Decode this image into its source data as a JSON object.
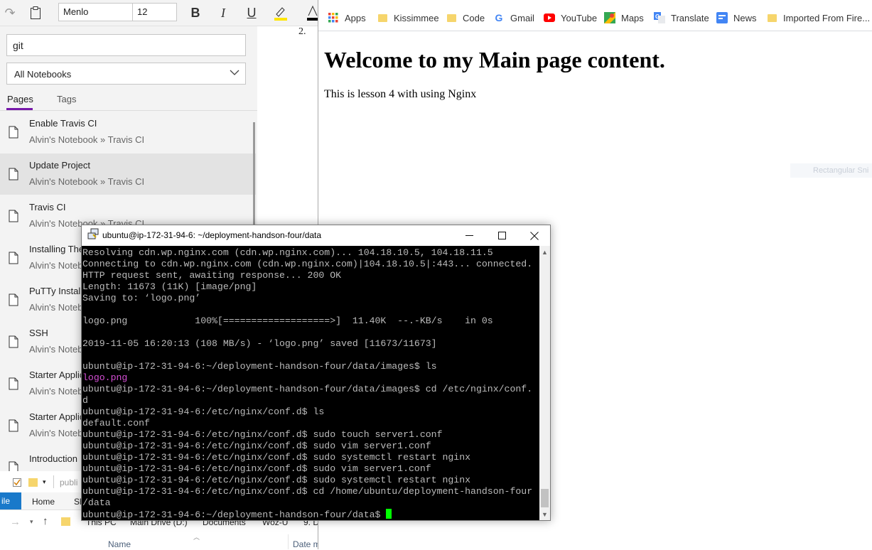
{
  "onenote": {
    "font_name": "Menlo",
    "font_size": "12",
    "search_value": "git",
    "notebook_filter": "All Notebooks",
    "tabs": [
      "Pages",
      "Tags"
    ],
    "results": [
      {
        "title": "Enable Travis CI",
        "path": "Alvin's Notebook » Travis CI",
        "selected": false
      },
      {
        "title": "Update Project",
        "path": "Alvin's Notebook » Travis CI",
        "selected": true
      },
      {
        "title": "Travis CI",
        "path": "Alvin's Notebook » Travis CI",
        "selected": false
      },
      {
        "title": "Installing The",
        "path": "Alvin's Noteb",
        "selected": false
      },
      {
        "title": "PuTTy Installa",
        "path": "Alvin's Noteb",
        "selected": false
      },
      {
        "title": "SSH",
        "path": "Alvin's Noteb",
        "selected": false
      },
      {
        "title": "Starter Applic",
        "path": "Alvin's Noteb",
        "selected": false
      },
      {
        "title": "Starter Applic",
        "path": "Alvin's Noteb",
        "selected": false
      },
      {
        "title": "Introduction",
        "path": "",
        "selected": false
      }
    ],
    "page_list_number": "2.",
    "accent_color": "#7719aa"
  },
  "explorer": {
    "qa_text": "publi",
    "ribbon_file": "ile",
    "ribbon_home": "Home",
    "ribbon_share": "Sh",
    "breadcrumbs": [
      "This PC",
      "Main Drive (D:)",
      "Documents",
      "Woz-U",
      "9. D"
    ],
    "col_name": "Name",
    "col_date": "Date m"
  },
  "chrome": {
    "bookmarks": [
      {
        "label": "Apps",
        "icon": "apps-grid-icon"
      },
      {
        "label": "Kissimmee",
        "icon": "folder-icon"
      },
      {
        "label": "Code",
        "icon": "folder-icon"
      },
      {
        "label": "Gmail",
        "icon": "google-icon"
      },
      {
        "label": "YouTube",
        "icon": "youtube-icon"
      },
      {
        "label": "Maps",
        "icon": "maps-icon"
      },
      {
        "label": "Translate",
        "icon": "translate-icon"
      },
      {
        "label": "News",
        "icon": "news-icon"
      },
      {
        "label": "Imported From Fire...",
        "icon": "folder-icon"
      }
    ],
    "heading": "Welcome to my Main page content.",
    "paragraph": "This is lesson 4 with using Nginx",
    "snip_tooltip": "Rectangular Sni"
  },
  "putty": {
    "title": "ubuntu@ip-172-31-94-6: ~/deployment-handson-four/data",
    "lines": [
      "Resolving cdn.wp.nginx.com (cdn.wp.nginx.com)... 104.18.10.5, 104.18.11.5",
      "Connecting to cdn.wp.nginx.com (cdn.wp.nginx.com)|104.18.10.5|:443... connected.",
      "HTTP request sent, awaiting response... 200 OK",
      "Length: 11673 (11K) [image/png]",
      "Saving to: ‘logo.png’",
      "",
      "logo.png            100%[===================>]  11.40K  --.-KB/s    in 0s",
      "",
      "2019-11-05 16:20:13 (108 MB/s) - ‘logo.png’ saved [11673/11673]",
      "",
      "ubuntu@ip-172-31-94-6:~/deployment-handson-four/data/images$ ls",
      "logo.png",
      "ubuntu@ip-172-31-94-6:~/deployment-handson-four/data/images$ cd /etc/nginx/conf.",
      "d",
      "ubuntu@ip-172-31-94-6:/etc/nginx/conf.d$ ls",
      "default.conf",
      "ubuntu@ip-172-31-94-6:/etc/nginx/conf.d$ sudo touch server1.conf",
      "ubuntu@ip-172-31-94-6:/etc/nginx/conf.d$ sudo vim server1.conf",
      "ubuntu@ip-172-31-94-6:/etc/nginx/conf.d$ sudo systemctl restart nginx",
      "ubuntu@ip-172-31-94-6:/etc/nginx/conf.d$ sudo vim server1.conf",
      "ubuntu@ip-172-31-94-6:/etc/nginx/conf.d$ sudo systemctl restart nginx",
      "ubuntu@ip-172-31-94-6:/etc/nginx/conf.d$ cd /home/ubuntu/deployment-handson-four",
      "/data",
      "ubuntu@ip-172-31-94-6:~/deployment-handson-four/data$ "
    ],
    "highlight_line_index": 11,
    "terminal_fg": "#bbbbbb",
    "terminal_bg": "#000000",
    "highlight_color": "#d44ed4",
    "cursor_color": "#00ff00"
  }
}
